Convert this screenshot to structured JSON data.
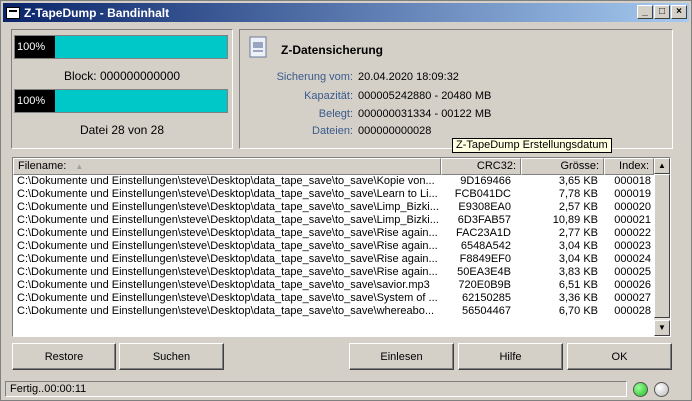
{
  "window": {
    "title": "Z-TapeDump - Bandinhalt",
    "buttons": {
      "minimize": "_",
      "maximize": "□",
      "close": "×"
    }
  },
  "progress": {
    "block": {
      "percent_label": "100%",
      "value": 100,
      "caption": "Block: 000000000000"
    },
    "file": {
      "percent_label": "100%",
      "value": 100,
      "caption": "Datei 28 von 28"
    }
  },
  "info": {
    "heading": "Z-Datensicherung",
    "rows": [
      {
        "label": "Sicherung vom:",
        "value": "20.04.2020 18:09:32"
      },
      {
        "label": "Kapazität:",
        "value": "000005242880 - 20480 MB"
      },
      {
        "label": "Belegt:",
        "value": "000000031334 - 00122 MB"
      },
      {
        "label": "Dateien:",
        "value": "000000000028"
      }
    ],
    "tooltip": "Z-TapeDump Erstellungsdatum"
  },
  "list": {
    "columns": [
      "Filename:",
      "CRC32:",
      "Grösse:",
      "Index:"
    ],
    "sort_indicator": "▲",
    "rows": [
      [
        "C:\\Dokumente und Einstellungen\\steve\\Desktop\\data_tape_save\\to_save\\Kopie von...",
        "9D169466",
        "3,65 KB",
        "000018"
      ],
      [
        "C:\\Dokumente und Einstellungen\\steve\\Desktop\\data_tape_save\\to_save\\Learn to Li...",
        "FCB041DC",
        "7,78 KB",
        "000019"
      ],
      [
        "C:\\Dokumente und Einstellungen\\steve\\Desktop\\data_tape_save\\to_save\\Limp_Bizki...",
        "E9308EA0",
        "2,57 KB",
        "000020"
      ],
      [
        "C:\\Dokumente und Einstellungen\\steve\\Desktop\\data_tape_save\\to_save\\Limp_Bizki...",
        "6D3FAB57",
        "10,89 KB",
        "000021"
      ],
      [
        "C:\\Dokumente und Einstellungen\\steve\\Desktop\\data_tape_save\\to_save\\Rise again...",
        "FAC23A1D",
        "2,77 KB",
        "000022"
      ],
      [
        "C:\\Dokumente und Einstellungen\\steve\\Desktop\\data_tape_save\\to_save\\Rise again...",
        "6548A542",
        "3,04 KB",
        "000023"
      ],
      [
        "C:\\Dokumente und Einstellungen\\steve\\Desktop\\data_tape_save\\to_save\\Rise again...",
        "F8849EF0",
        "3,04 KB",
        "000024"
      ],
      [
        "C:\\Dokumente und Einstellungen\\steve\\Desktop\\data_tape_save\\to_save\\Rise again...",
        "50EA3E4B",
        "3,83 KB",
        "000025"
      ],
      [
        "C:\\Dokumente und Einstellungen\\steve\\Desktop\\data_tape_save\\to_save\\savior.mp3",
        "720E0B9B",
        "6,51 KB",
        "000026"
      ],
      [
        "C:\\Dokumente und Einstellungen\\steve\\Desktop\\data_tape_save\\to_save\\System of ...",
        "62150285",
        "3,36 KB",
        "000027"
      ],
      [
        "C:\\Dokumente und Einstellungen\\steve\\Desktop\\data_tape_save\\to_save\\whereabo...",
        "56504467",
        "6,70 KB",
        "000028"
      ]
    ]
  },
  "buttons": {
    "restore": "Restore",
    "search": "Suchen",
    "read": "Einlesen",
    "help": "Hilfe",
    "ok": "OK"
  },
  "status": {
    "text": "Fertig..00:00:11",
    "led_colors": [
      "#22bb22",
      "#b8b8b8"
    ]
  },
  "colors": {
    "title_bar": "#0a246a",
    "progress_fill": "#00c8c8",
    "label_blue": "#3a5a8c"
  }
}
